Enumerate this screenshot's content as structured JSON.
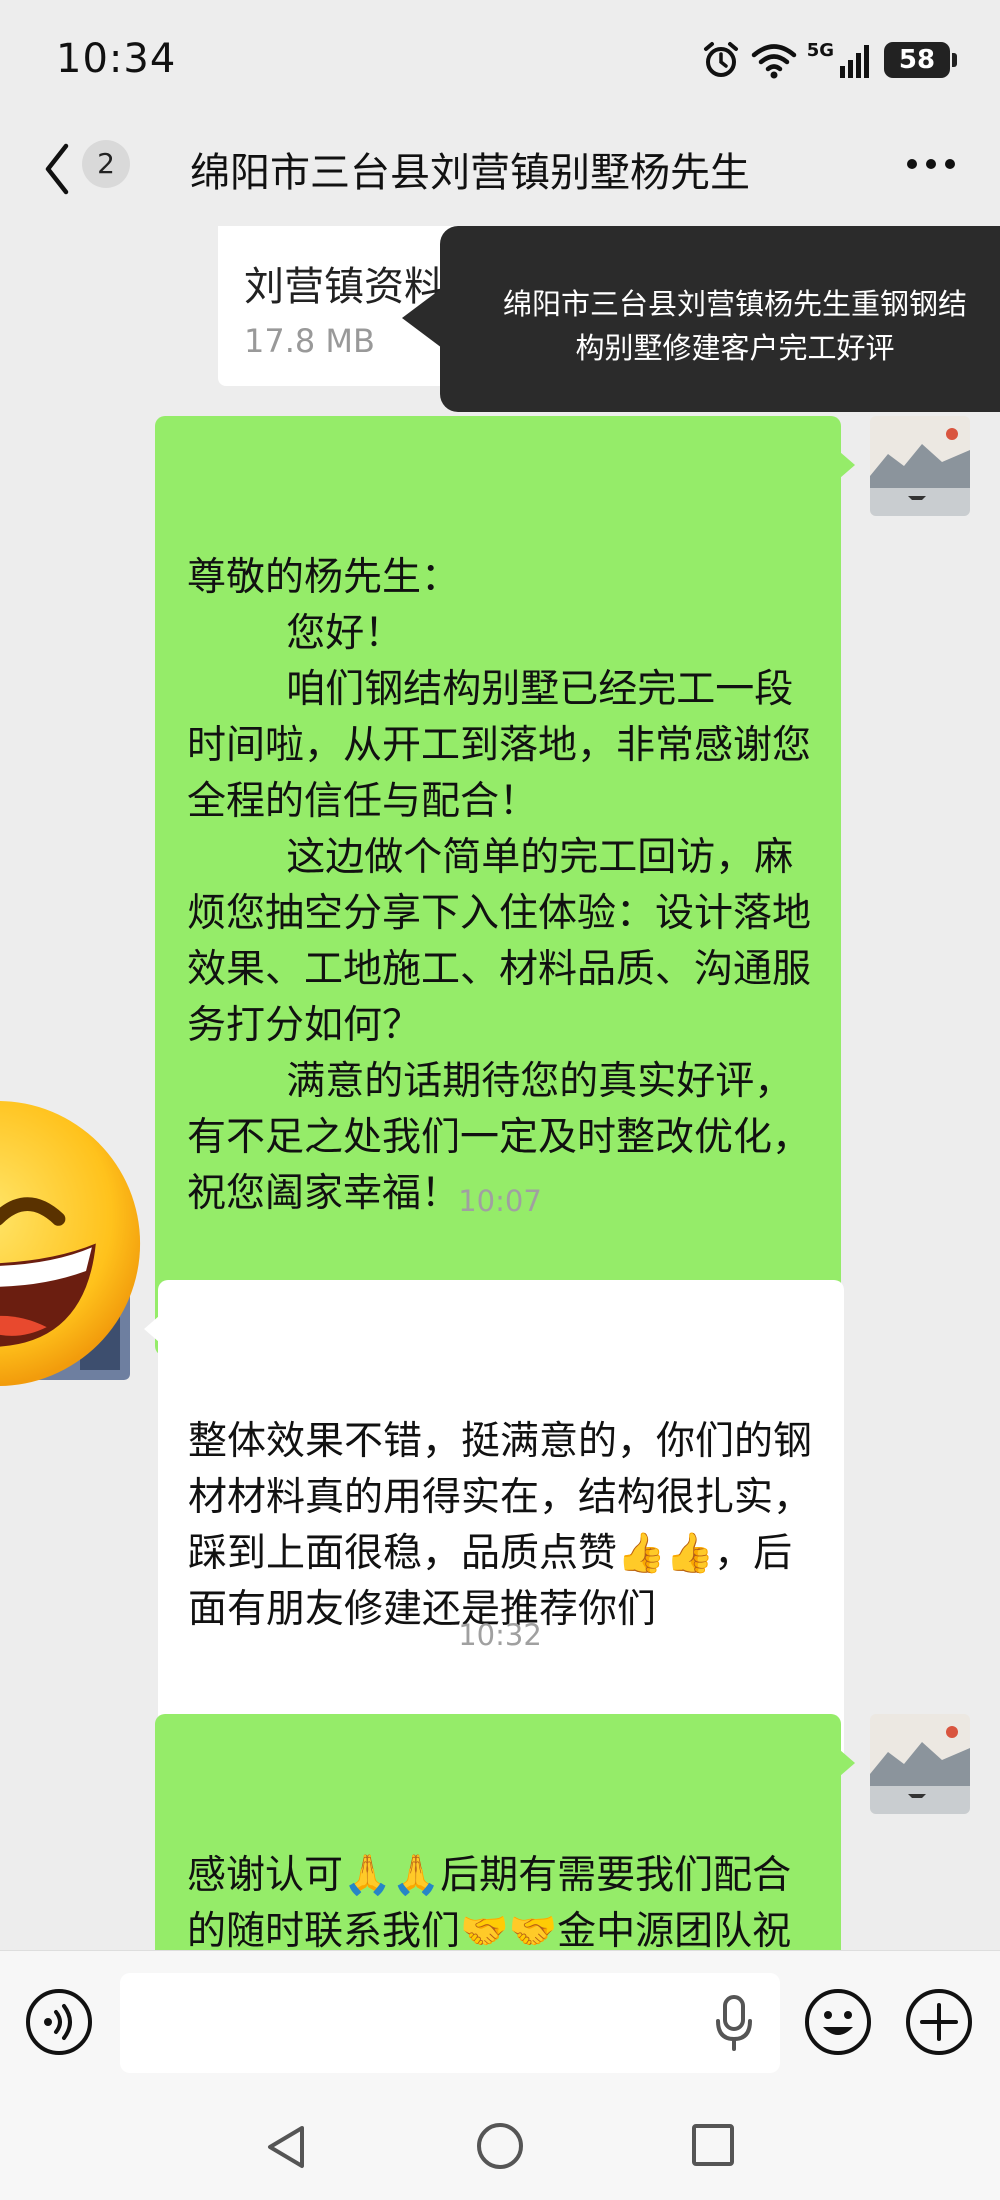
{
  "status": {
    "time": "10:34",
    "network": "5G",
    "battery": "58"
  },
  "header": {
    "unread_count": "2",
    "title": "绵阳市三台县刘营镇别墅杨先生"
  },
  "file_message": {
    "name": "刘营镇资料.pdf",
    "size": "17.8 MB"
  },
  "tooltip": {
    "text": "绵阳市三台县刘营镇杨先生重钢钢结构别墅修建客户完工好评"
  },
  "messages": [
    {
      "side": "sent",
      "text": "尊敬的杨先生：\n        您好！\n        咱们钢结构别墅已经完工一段时间啦，从开工到落地，非常感谢您全程的信任与配合！\n        这边做个简单的完工回访，麻烦您抽空分享下入住体验：设计落地效果、工地施工、材料品质、沟通服务打分如何？\n        满意的话期待您的真实好评，有不足之处我们一定及时整改优化，祝您阖家幸福！"
    },
    {
      "side": "time",
      "text": "10:07"
    },
    {
      "side": "received",
      "text": "整体效果不错，挺满意的，你们的钢材材料真的用得实在，结构很扎实，踩到上面很稳，品质点赞👍👍，后面有朋友修建还是推荐你们"
    },
    {
      "side": "time",
      "text": "10:32"
    },
    {
      "side": "sent",
      "text": "感谢认可🙏🙏后期有需要我们配合的随时联系我们🤝🤝金中源团队祝您生活愉快！"
    }
  ],
  "input": {
    "placeholder": ""
  },
  "icons": {
    "back": "chevron-left-icon",
    "more": "ellipsis-icon",
    "voice": "voice-icon",
    "mic": "microphone-icon",
    "emoji": "smiley-icon",
    "plus": "plus-icon"
  },
  "colors": {
    "sent_bubble": "#95ec69",
    "received_bubble": "#ffffff",
    "background": "#ededed",
    "tooltip": "#2b2b2b"
  }
}
